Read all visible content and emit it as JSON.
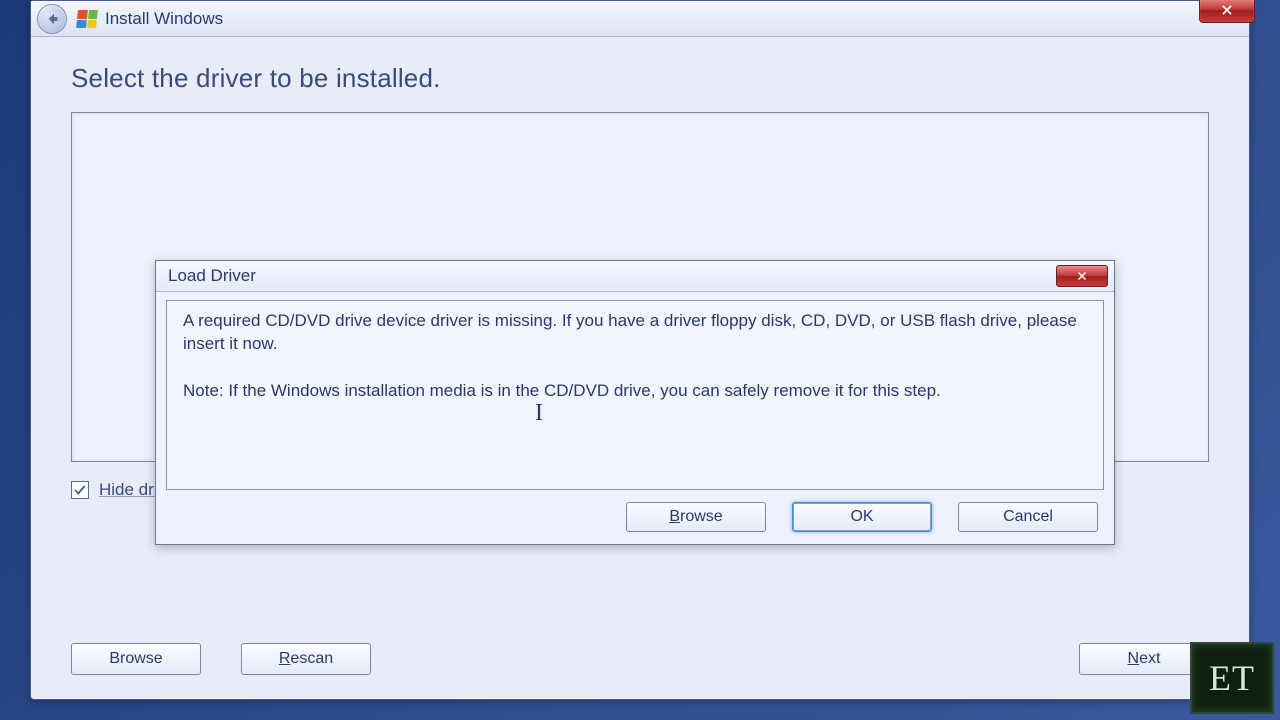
{
  "titlebar": {
    "title": "Install Windows"
  },
  "page": {
    "heading": "Select the driver to be installed.",
    "hide_checkbox_checked": true,
    "hide_label": "Hide drivers that are not compatible with hardware on this computer."
  },
  "buttons": {
    "browse": "Browse",
    "rescan_prefix": "R",
    "rescan_rest": "escan",
    "next_prefix": "N",
    "next_rest": "ext"
  },
  "modal": {
    "title": "Load Driver",
    "message": "A required CD/DVD drive device driver is missing. If you have a driver floppy disk, CD, DVD, or USB flash drive, please insert it now.\n\nNote: If the Windows installation media is in the CD/DVD drive, you can safely remove it for this step.",
    "browse_prefix": "B",
    "browse_rest": "rowse",
    "ok": "OK",
    "cancel": "Cancel"
  },
  "logo": {
    "text": "ET"
  }
}
